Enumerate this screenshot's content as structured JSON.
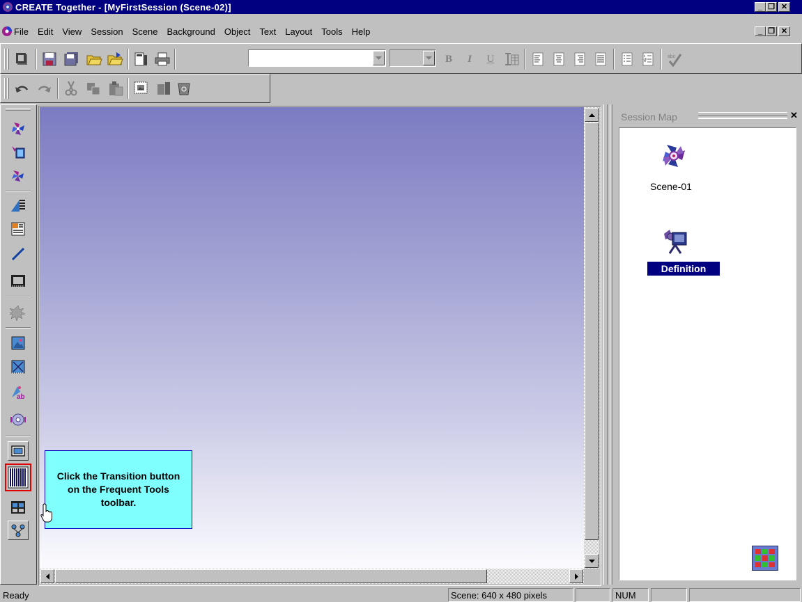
{
  "window": {
    "title": "CREATE Together - [MyFirstSession (Scene-02)]",
    "min_glyph": "_",
    "restore_glyph": "❐",
    "close_glyph": "✕"
  },
  "menu": {
    "items": [
      "File",
      "Edit",
      "View",
      "Session",
      "Scene",
      "Background",
      "Object",
      "Text",
      "Layout",
      "Tools",
      "Help"
    ]
  },
  "formatting": {
    "bold": "B",
    "italic": "I",
    "underline": "U"
  },
  "session_map": {
    "title": "Session Map",
    "close_glyph": "✕",
    "nodes": [
      {
        "label": "Scene-01",
        "icon": "scene-pinwheel-icon"
      },
      {
        "label": "Definition",
        "icon": "definition-scene-icon",
        "selected": true
      }
    ]
  },
  "callout": {
    "text": "Click the Transition button on the Frequent Tools toolbar."
  },
  "status": {
    "ready": "Ready",
    "scene_size": "Scene: 640 x 480 pixels",
    "num": "NUM"
  },
  "colors": {
    "titlebar": "#000080",
    "selection": "#000080",
    "callout_bg": "#80ffff",
    "highlight_border": "#e00000"
  }
}
